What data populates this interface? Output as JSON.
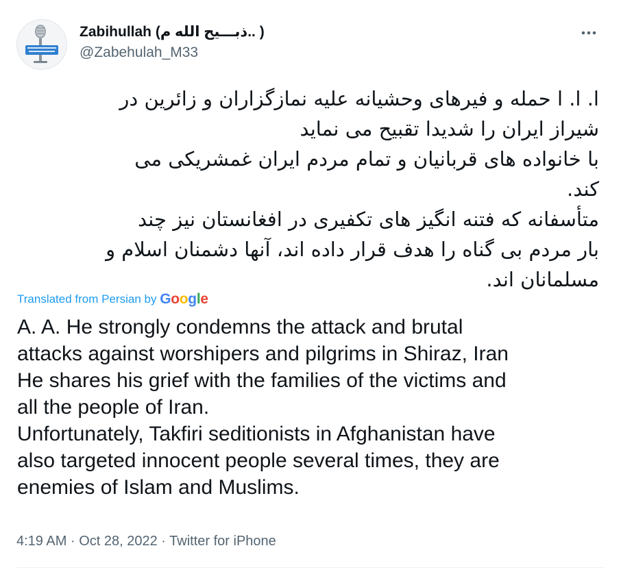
{
  "tweet": {
    "display_name": "Zabihullah (ذبـــیح الله م.. )",
    "handle": "@Zabehulah_M33",
    "more_icon": "ellipsis-icon",
    "original_text": "ا. ا. ا حمله و فیرهای وحشیانه علیه نمازگزاران و زائرین در\nشیراز ایران را شدیدا تقبیح می نماید\nبا خانواده های قربانیان و تمام مردم ایران غمشریکی می\nکند.\nمتأسفانه که فتنه انگیز های تکفیری در افغانستان نیز چند\nبار مردم بی گناه را هدف قرار داده اند، آنها دشمنان اسلام و\nمسلمانان اند.",
    "translated_label": "Translated from Persian by",
    "translator_brand": {
      "letters": [
        "G",
        "o",
        "o",
        "g",
        "l",
        "e"
      ],
      "colors": [
        "#4285F4",
        "#EA4335",
        "#FBBC05",
        "#4285F4",
        "#34A853",
        "#EA4335"
      ]
    },
    "translated_text": "A. A. He strongly condemns the attack and brutal\nattacks against worshipers and pilgrims in Shiraz, Iran\nHe shares his grief with the families of the victims and\nall the people of Iran.\nUnfortunately, Takfiri seditionists in Afghanistan have\nalso targeted innocent people several times, they are\nenemies of Islam and Muslims.",
    "time": "4:19 AM",
    "date": "Oct 28, 2022",
    "separator": "·",
    "source": "Twitter for iPhone"
  },
  "colors": {
    "link": "#1d9bf0",
    "secondary_text": "#536471",
    "primary_text": "#0f1419"
  }
}
